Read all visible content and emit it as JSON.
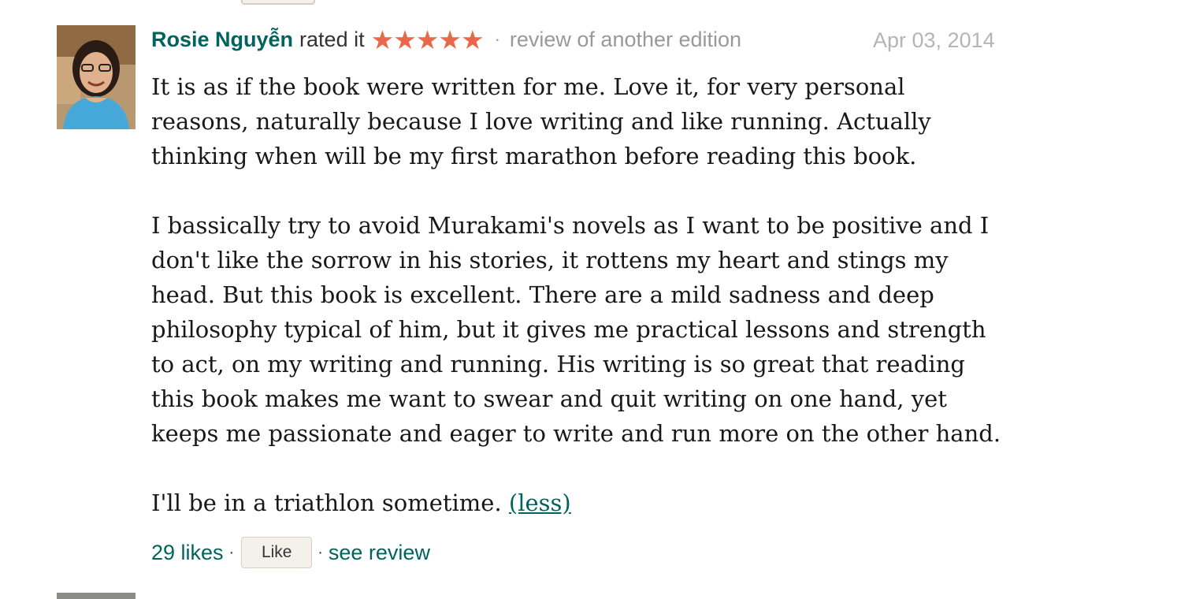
{
  "review": {
    "reviewer_name": "Rosie Nguyễn",
    "rated_text": "rated it",
    "rating": 5,
    "rating_max": 5,
    "star_color": "#e9684c",
    "separator": "·",
    "edition_text": "review of another edition",
    "date": "Apr 03, 2014",
    "paragraphs": [
      "It is as if the book were written for me. Love it, for very personal reasons, naturally because I love writing and like running. Actually thinking when will be my first marathon before reading this book.",
      "I bassically try to avoid Murakami's novels as I want to be positive and I don't like the sorrow in his stories, it rottens my heart and stings my head. But this book is excellent. There are a mild sadness and deep philosophy typical of him, but it gives me practical lessons and strength to act, on my writing and running. His writing is so great that reading this book makes me want to swear and quit writing on one hand, yet keeps me passionate and eager to write and run more on the other hand.",
      "I'll be in a triathlon sometime."
    ],
    "less_label": "(less)",
    "likes_label": "29 likes",
    "like_button_label": "Like",
    "see_review_label": "see review"
  },
  "colors": {
    "link": "#00635d",
    "muted": "#999999",
    "date": "#b5b5b5",
    "text": "#181818",
    "button_bg": "#f4f1ea",
    "button_border": "#d6d0c4"
  }
}
